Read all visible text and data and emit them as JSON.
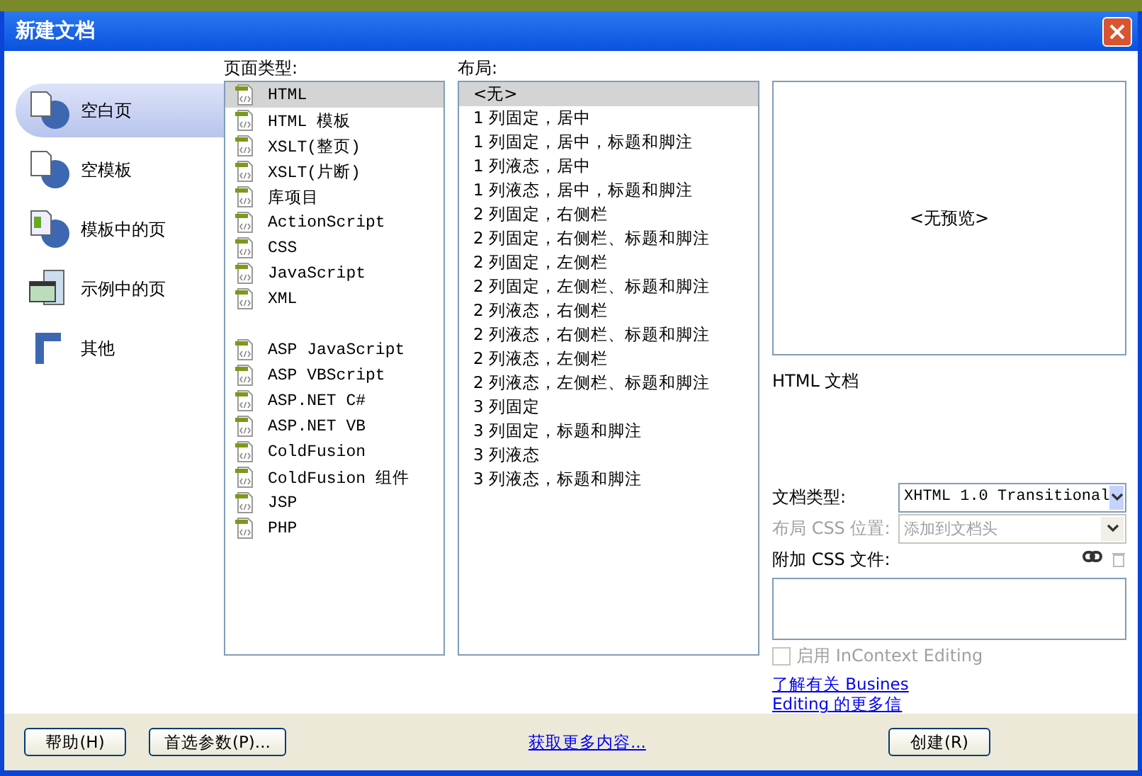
{
  "window": {
    "title": "新建文档"
  },
  "categories": [
    {
      "label": "空白页",
      "selected": true,
      "kind": "page"
    },
    {
      "label": "空模板",
      "selected": false,
      "kind": "template"
    },
    {
      "label": "模板中的页",
      "selected": false,
      "kind": "templatepage"
    },
    {
      "label": "示例中的页",
      "selected": false,
      "kind": "sample"
    },
    {
      "label": "其他",
      "selected": false,
      "kind": "other"
    }
  ],
  "page_types": {
    "label": "页面类型:",
    "groups": [
      [
        {
          "label": "HTML",
          "selected": true
        },
        {
          "label": "HTML 模板",
          "selected": false
        },
        {
          "label": "XSLT(整页)",
          "selected": false
        },
        {
          "label": "XSLT(片断)",
          "selected": false
        },
        {
          "label": "库项目",
          "selected": false
        },
        {
          "label": "ActionScript",
          "selected": false
        },
        {
          "label": "CSS",
          "selected": false
        },
        {
          "label": "JavaScript",
          "selected": false
        },
        {
          "label": "XML",
          "selected": false
        }
      ],
      [
        {
          "label": "ASP JavaScript",
          "selected": false
        },
        {
          "label": "ASP VBScript",
          "selected": false
        },
        {
          "label": "ASP.NET C#",
          "selected": false
        },
        {
          "label": "ASP.NET VB",
          "selected": false
        },
        {
          "label": "ColdFusion",
          "selected": false
        },
        {
          "label": "ColdFusion 组件",
          "selected": false
        },
        {
          "label": "JSP",
          "selected": false
        },
        {
          "label": "PHP",
          "selected": false
        }
      ]
    ]
  },
  "layout": {
    "label": "布局:",
    "items": [
      {
        "label": "<无>",
        "selected": true
      },
      {
        "label": "1 列固定，居中",
        "selected": false
      },
      {
        "label": "1 列固定，居中，标题和脚注",
        "selected": false
      },
      {
        "label": "1 列液态，居中",
        "selected": false
      },
      {
        "label": "1 列液态，居中，标题和脚注",
        "selected": false
      },
      {
        "label": "2 列固定，右侧栏",
        "selected": false
      },
      {
        "label": "2 列固定，右侧栏、标题和脚注",
        "selected": false
      },
      {
        "label": "2 列固定，左侧栏",
        "selected": false
      },
      {
        "label": "2 列固定，左侧栏、标题和脚注",
        "selected": false
      },
      {
        "label": "2 列液态，右侧栏",
        "selected": false
      },
      {
        "label": "2 列液态，右侧栏、标题和脚注",
        "selected": false
      },
      {
        "label": "2 列液态，左侧栏",
        "selected": false
      },
      {
        "label": "2 列液态，左侧栏、标题和脚注",
        "selected": false
      },
      {
        "label": "3 列固定",
        "selected": false
      },
      {
        "label": "3 列固定，标题和脚注",
        "selected": false
      },
      {
        "label": "3 列液态",
        "selected": false
      },
      {
        "label": "3 列液态，标题和脚注",
        "selected": false
      }
    ]
  },
  "preview": {
    "text": "<无预览>",
    "description": "HTML 文档"
  },
  "doc_type": {
    "label": "文档类型:",
    "value": "XHTML 1.0 Transitional",
    "disabled": false
  },
  "layout_css": {
    "label": "布局 CSS 位置:",
    "value": "添加到文档头",
    "disabled": true
  },
  "attach_css": {
    "label": "附加 CSS 文件:"
  },
  "incontext": {
    "label": "启用 InContext Editing",
    "checked": false,
    "disabled": true
  },
  "learn_more": [
    "了解有关 Busines",
    "Editing 的更多信"
  ],
  "footer": {
    "help": "帮助(H)",
    "prefs": "首选参数(P)...",
    "more": "获取更多内容...",
    "create": "创建(R)"
  }
}
